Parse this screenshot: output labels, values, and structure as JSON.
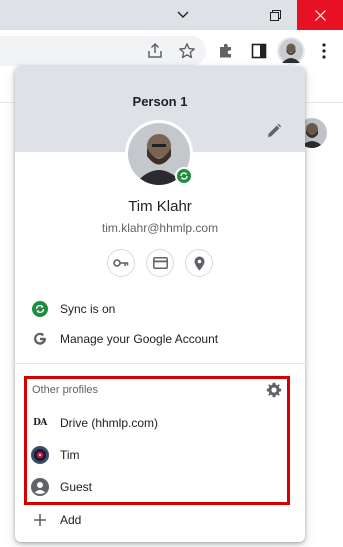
{
  "window": {
    "icons": [
      "chevron-down-icon",
      "restore-icon",
      "close-icon"
    ],
    "colors": {
      "titlebar": "#dee1e6",
      "close": "#e81123"
    }
  },
  "toolbar": {
    "icons": [
      "share-icon",
      "star-icon",
      "extensions-icon",
      "side-panel-icon",
      "profile-avatar",
      "more-menu-icon"
    ]
  },
  "profile_menu": {
    "profile_name": "Person 1",
    "user_name": "Tim Klahr",
    "email": "tim.klahr@hhmlp.com",
    "quick_actions": [
      "key-icon",
      "credit-card-icon",
      "location-pin-icon"
    ],
    "sync_label": "Sync is on",
    "manage_label": "Manage your Google Account",
    "other_profiles": {
      "heading": "Other profiles",
      "items": [
        {
          "label": "Drive (hhmlp.com)",
          "icon_text": "DA"
        },
        {
          "label": "Tim"
        },
        {
          "label": "Guest"
        }
      ]
    },
    "add_label": "Add",
    "colors": {
      "header": "#dee1e6",
      "sync_green": "#1e8e3e",
      "highlight": "#d40000"
    }
  }
}
